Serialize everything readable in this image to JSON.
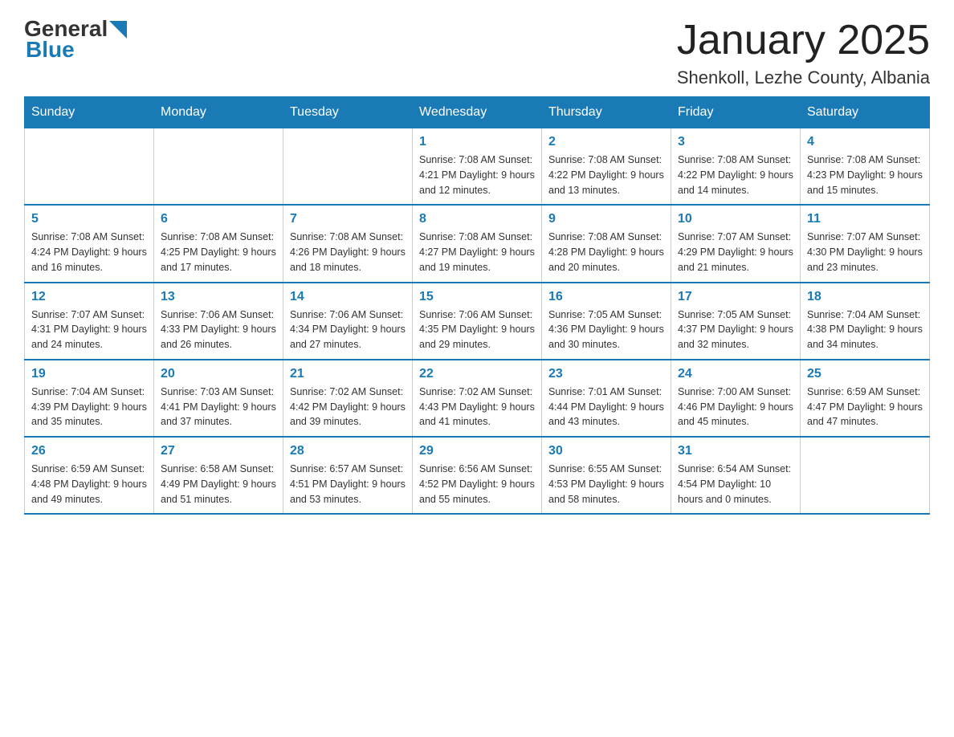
{
  "header": {
    "logo_general": "General",
    "logo_blue": "Blue",
    "title": "January 2025",
    "subtitle": "Shenkoll, Lezhe County, Albania"
  },
  "calendar": {
    "days_of_week": [
      "Sunday",
      "Monday",
      "Tuesday",
      "Wednesday",
      "Thursday",
      "Friday",
      "Saturday"
    ],
    "weeks": [
      [
        {
          "day": "",
          "info": ""
        },
        {
          "day": "",
          "info": ""
        },
        {
          "day": "",
          "info": ""
        },
        {
          "day": "1",
          "info": "Sunrise: 7:08 AM\nSunset: 4:21 PM\nDaylight: 9 hours and 12 minutes."
        },
        {
          "day": "2",
          "info": "Sunrise: 7:08 AM\nSunset: 4:22 PM\nDaylight: 9 hours and 13 minutes."
        },
        {
          "day": "3",
          "info": "Sunrise: 7:08 AM\nSunset: 4:22 PM\nDaylight: 9 hours and 14 minutes."
        },
        {
          "day": "4",
          "info": "Sunrise: 7:08 AM\nSunset: 4:23 PM\nDaylight: 9 hours and 15 minutes."
        }
      ],
      [
        {
          "day": "5",
          "info": "Sunrise: 7:08 AM\nSunset: 4:24 PM\nDaylight: 9 hours and 16 minutes."
        },
        {
          "day": "6",
          "info": "Sunrise: 7:08 AM\nSunset: 4:25 PM\nDaylight: 9 hours and 17 minutes."
        },
        {
          "day": "7",
          "info": "Sunrise: 7:08 AM\nSunset: 4:26 PM\nDaylight: 9 hours and 18 minutes."
        },
        {
          "day": "8",
          "info": "Sunrise: 7:08 AM\nSunset: 4:27 PM\nDaylight: 9 hours and 19 minutes."
        },
        {
          "day": "9",
          "info": "Sunrise: 7:08 AM\nSunset: 4:28 PM\nDaylight: 9 hours and 20 minutes."
        },
        {
          "day": "10",
          "info": "Sunrise: 7:07 AM\nSunset: 4:29 PM\nDaylight: 9 hours and 21 minutes."
        },
        {
          "day": "11",
          "info": "Sunrise: 7:07 AM\nSunset: 4:30 PM\nDaylight: 9 hours and 23 minutes."
        }
      ],
      [
        {
          "day": "12",
          "info": "Sunrise: 7:07 AM\nSunset: 4:31 PM\nDaylight: 9 hours and 24 minutes."
        },
        {
          "day": "13",
          "info": "Sunrise: 7:06 AM\nSunset: 4:33 PM\nDaylight: 9 hours and 26 minutes."
        },
        {
          "day": "14",
          "info": "Sunrise: 7:06 AM\nSunset: 4:34 PM\nDaylight: 9 hours and 27 minutes."
        },
        {
          "day": "15",
          "info": "Sunrise: 7:06 AM\nSunset: 4:35 PM\nDaylight: 9 hours and 29 minutes."
        },
        {
          "day": "16",
          "info": "Sunrise: 7:05 AM\nSunset: 4:36 PM\nDaylight: 9 hours and 30 minutes."
        },
        {
          "day": "17",
          "info": "Sunrise: 7:05 AM\nSunset: 4:37 PM\nDaylight: 9 hours and 32 minutes."
        },
        {
          "day": "18",
          "info": "Sunrise: 7:04 AM\nSunset: 4:38 PM\nDaylight: 9 hours and 34 minutes."
        }
      ],
      [
        {
          "day": "19",
          "info": "Sunrise: 7:04 AM\nSunset: 4:39 PM\nDaylight: 9 hours and 35 minutes."
        },
        {
          "day": "20",
          "info": "Sunrise: 7:03 AM\nSunset: 4:41 PM\nDaylight: 9 hours and 37 minutes."
        },
        {
          "day": "21",
          "info": "Sunrise: 7:02 AM\nSunset: 4:42 PM\nDaylight: 9 hours and 39 minutes."
        },
        {
          "day": "22",
          "info": "Sunrise: 7:02 AM\nSunset: 4:43 PM\nDaylight: 9 hours and 41 minutes."
        },
        {
          "day": "23",
          "info": "Sunrise: 7:01 AM\nSunset: 4:44 PM\nDaylight: 9 hours and 43 minutes."
        },
        {
          "day": "24",
          "info": "Sunrise: 7:00 AM\nSunset: 4:46 PM\nDaylight: 9 hours and 45 minutes."
        },
        {
          "day": "25",
          "info": "Sunrise: 6:59 AM\nSunset: 4:47 PM\nDaylight: 9 hours and 47 minutes."
        }
      ],
      [
        {
          "day": "26",
          "info": "Sunrise: 6:59 AM\nSunset: 4:48 PM\nDaylight: 9 hours and 49 minutes."
        },
        {
          "day": "27",
          "info": "Sunrise: 6:58 AM\nSunset: 4:49 PM\nDaylight: 9 hours and 51 minutes."
        },
        {
          "day": "28",
          "info": "Sunrise: 6:57 AM\nSunset: 4:51 PM\nDaylight: 9 hours and 53 minutes."
        },
        {
          "day": "29",
          "info": "Sunrise: 6:56 AM\nSunset: 4:52 PM\nDaylight: 9 hours and 55 minutes."
        },
        {
          "day": "30",
          "info": "Sunrise: 6:55 AM\nSunset: 4:53 PM\nDaylight: 9 hours and 58 minutes."
        },
        {
          "day": "31",
          "info": "Sunrise: 6:54 AM\nSunset: 4:54 PM\nDaylight: 10 hours and 0 minutes."
        },
        {
          "day": "",
          "info": ""
        }
      ]
    ]
  }
}
